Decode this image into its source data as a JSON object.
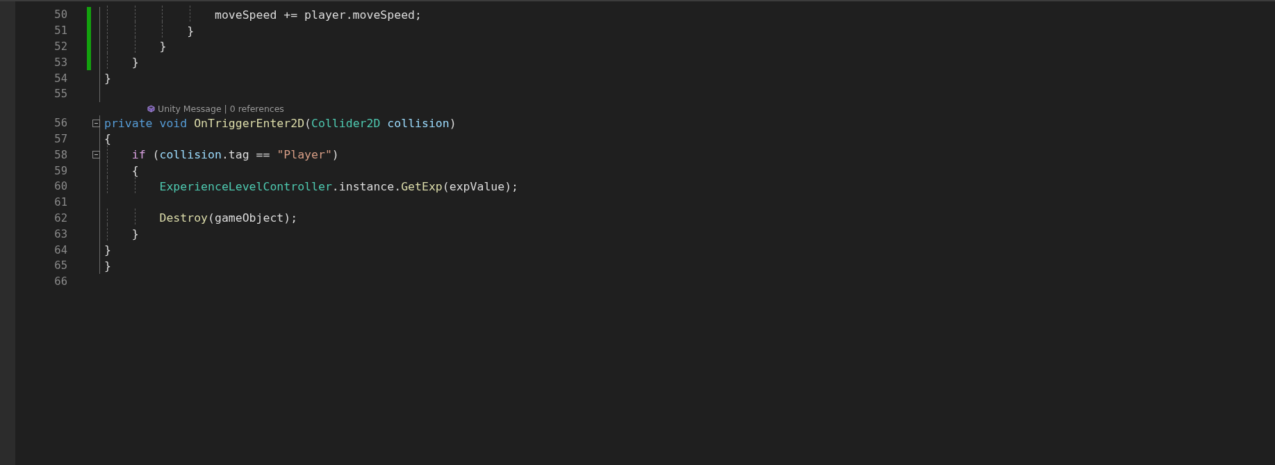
{
  "lines": [
    {
      "kind": "code",
      "number": "50",
      "modified": true,
      "fold": false,
      "tokens": [
        {
          "text": "                moveSpeed += player.moveSpeed;",
          "kind": "plain"
        }
      ]
    },
    {
      "kind": "code",
      "number": "51",
      "modified": true,
      "fold": false,
      "tokens": [
        {
          "text": "            }",
          "kind": "plain"
        }
      ]
    },
    {
      "kind": "code",
      "number": "52",
      "modified": true,
      "fold": false,
      "tokens": [
        {
          "text": "        }",
          "kind": "plain"
        }
      ]
    },
    {
      "kind": "code",
      "number": "53",
      "modified": true,
      "fold": false,
      "tokens": [
        {
          "text": "    }",
          "kind": "plain"
        }
      ]
    },
    {
      "kind": "code",
      "number": "54",
      "modified": false,
      "fold": false,
      "tokens": [
        {
          "text": "}",
          "kind": "plain"
        }
      ]
    },
    {
      "kind": "code",
      "number": "55",
      "modified": false,
      "fold": false
    },
    {
      "kind": "codelens",
      "text": "Unity Message | 0 references"
    },
    {
      "kind": "code",
      "number": "56",
      "modified": false,
      "fold": true,
      "tokens": [
        {
          "text": "private",
          "kind": "keyword"
        },
        {
          "text": " void",
          "kind": "keyword"
        },
        {
          "text": " OnTriggerEnter2D",
          "kind": "method"
        },
        {
          "text": "(",
          "kind": "plain"
        },
        {
          "text": "Collider2D",
          "kind": "type"
        },
        {
          "text": " collision",
          "kind": "param"
        },
        {
          "text": ")",
          "kind": "plain"
        }
      ]
    },
    {
      "kind": "code",
      "number": "57",
      "modified": false,
      "fold": false,
      "tokens": [
        {
          "text": "{",
          "kind": "plain"
        }
      ]
    },
    {
      "kind": "code",
      "number": "58",
      "modified": false,
      "fold": true,
      "tokens": [
        {
          "text": "    if",
          "kind": "control"
        },
        {
          "text": " (",
          "kind": "plain"
        },
        {
          "text": "collision",
          "kind": "param"
        },
        {
          "text": ".tag == ",
          "kind": "plain"
        },
        {
          "text": "\"Player\"",
          "kind": "string"
        },
        {
          "text": ")",
          "kind": "plain"
        }
      ]
    },
    {
      "kind": "code",
      "number": "59",
      "modified": false,
      "fold": false,
      "tokens": [
        {
          "text": "    {",
          "kind": "plain"
        }
      ]
    },
    {
      "kind": "code",
      "number": "60",
      "modified": false,
      "fold": false,
      "tokens": [
        {
          "text": "        ExperienceLevelController",
          "kind": "type"
        },
        {
          "text": ".instance.",
          "kind": "plain"
        },
        {
          "text": "GetExp",
          "kind": "method"
        },
        {
          "text": "(expValue);",
          "kind": "plain"
        }
      ]
    },
    {
      "kind": "code",
      "number": "61",
      "modified": false,
      "fold": false
    },
    {
      "kind": "code",
      "number": "62",
      "modified": false,
      "fold": false,
      "tokens": [
        {
          "text": "        Destroy",
          "kind": "method"
        },
        {
          "text": "(gameObject);",
          "kind": "plain"
        }
      ]
    },
    {
      "kind": "code",
      "number": "63",
      "modified": false,
      "fold": false,
      "tokens": [
        {
          "text": "    }",
          "kind": "plain"
        }
      ]
    },
    {
      "kind": "code",
      "number": "64",
      "modified": false,
      "fold": false,
      "tokens": [
        {
          "text": "}",
          "kind": "plain"
        }
      ]
    },
    {
      "kind": "code",
      "number": "65",
      "modified": false,
      "fold": false,
      "tokens": [
        {
          "text": "}",
          "kind": "plain"
        }
      ]
    },
    {
      "kind": "code",
      "number": "66",
      "modified": false,
      "fold": false
    }
  ]
}
